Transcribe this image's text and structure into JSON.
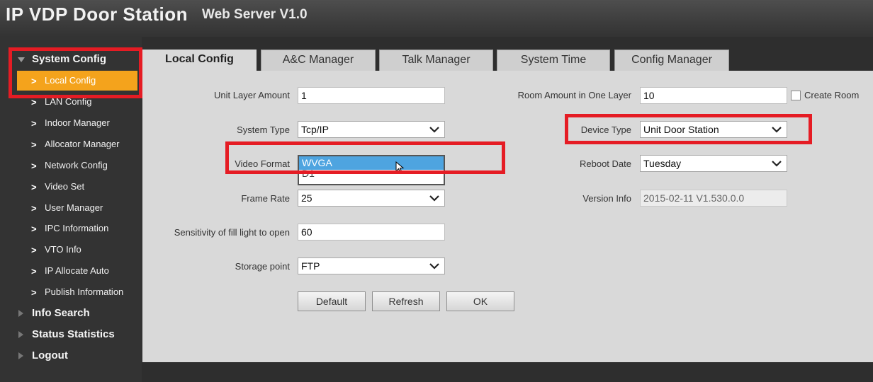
{
  "header": {
    "title": "IP VDP Door Station",
    "subtitle": "Web Server V1.0"
  },
  "sidebar": {
    "system_config": "System Config",
    "items": [
      {
        "label": "Local Config"
      },
      {
        "label": "LAN Config"
      },
      {
        "label": "Indoor Manager"
      },
      {
        "label": "Allocator Manager"
      },
      {
        "label": "Network Config"
      },
      {
        "label": "Video Set"
      },
      {
        "label": "User Manager"
      },
      {
        "label": "IPC Information"
      },
      {
        "label": "VTO Info"
      },
      {
        "label": "IP Allocate Auto"
      },
      {
        "label": "Publish Information"
      }
    ],
    "info_search": "Info Search",
    "status_statistics": "Status Statistics",
    "logout": "Logout"
  },
  "tabs": [
    {
      "label": "Local Config"
    },
    {
      "label": "A&C Manager"
    },
    {
      "label": "Talk Manager"
    },
    {
      "label": "System Time"
    },
    {
      "label": "Config Manager"
    }
  ],
  "form": {
    "unit_layer_amount": {
      "label": "Unit Layer Amount",
      "value": "1"
    },
    "system_type": {
      "label": "System Type",
      "value": "Tcp/IP"
    },
    "video_format": {
      "label": "Video Format",
      "selected": "WVGA",
      "other_option": "D1"
    },
    "frame_rate": {
      "label": "Frame Rate",
      "value": "25"
    },
    "sensitivity": {
      "label": "Sensitivity of fill light to open",
      "value": "60"
    },
    "storage_point": {
      "label": "Storage point",
      "value": "FTP"
    },
    "room_amount": {
      "label": "Room Amount in One Layer",
      "value": "10"
    },
    "create_room": {
      "label": "Create Room",
      "checked": false
    },
    "device_type": {
      "label": "Device Type",
      "value": "Unit Door Station"
    },
    "reboot_date": {
      "label": "Reboot Date",
      "value": "Tuesday"
    },
    "version_info": {
      "label": "Version Info",
      "value": "2015-02-11 V1.530.0.0"
    }
  },
  "buttons": {
    "default": "Default",
    "refresh": "Refresh",
    "ok": "OK"
  },
  "colors": {
    "accent": "#f4a31c",
    "highlight": "#e51c24",
    "selection": "#4ea4e0"
  }
}
